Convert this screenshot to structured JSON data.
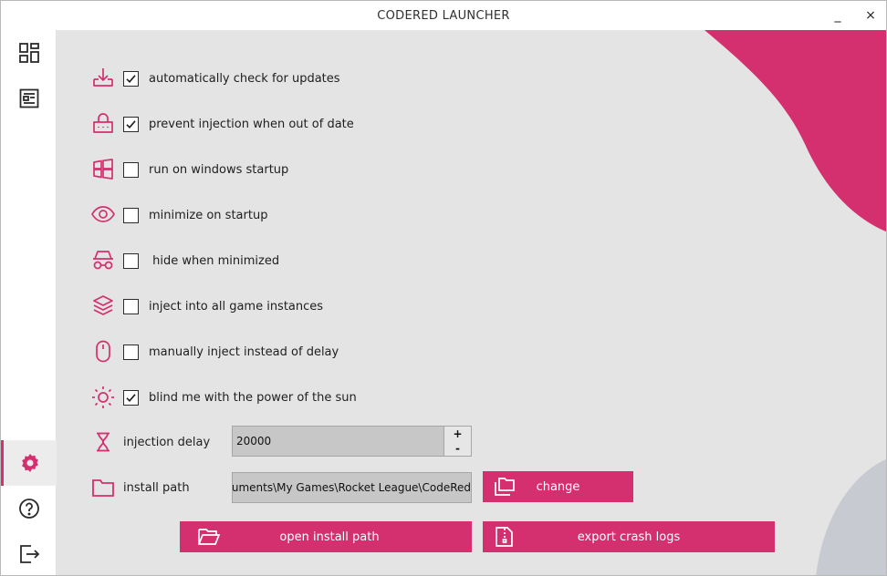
{
  "window": {
    "title": "CODERED LAUNCHER",
    "minimize": "_",
    "close": "×"
  },
  "colors": {
    "accent": "#d42f6e",
    "background": "#e4e4e4",
    "sidebar": "#ffffff",
    "blob_gray": "#c7cbd1"
  },
  "sidebar": {
    "items": [
      {
        "name": "dashboard",
        "icon": "dashboard-icon",
        "active": false
      },
      {
        "name": "news",
        "icon": "news-icon",
        "active": false
      },
      {
        "name": "settings",
        "icon": "gear-icon",
        "active": true
      },
      {
        "name": "help",
        "icon": "question-icon",
        "active": false
      },
      {
        "name": "exit",
        "icon": "exit-icon",
        "active": false
      }
    ]
  },
  "settings": {
    "options": [
      {
        "icon": "download-icon",
        "label": "automatically check for updates",
        "checked": true
      },
      {
        "icon": "lock-icon",
        "label": "prevent injection when out of date",
        "checked": true
      },
      {
        "icon": "windows-icon",
        "label": "run on windows startup",
        "checked": false
      },
      {
        "icon": "eye-icon",
        "label": "minimize on startup",
        "checked": false
      },
      {
        "icon": "incognito-icon",
        "label": " hide when minimized",
        "checked": false
      },
      {
        "icon": "layers-icon",
        "label": "inject into all game instances",
        "checked": false
      },
      {
        "icon": "mouse-icon",
        "label": "manually inject instead of delay",
        "checked": false
      },
      {
        "icon": "sun-icon",
        "label": "blind me with the power of the sun",
        "checked": true
      }
    ],
    "injection_delay": {
      "icon": "hourglass-icon",
      "label": "injection delay",
      "value": "20000",
      "increment": "+",
      "decrement": "-"
    },
    "install_path": {
      "icon": "folder-icon",
      "label": "install path",
      "value": "Documents\\My Games\\Rocket League\\CodeRed",
      "change_button": "change"
    },
    "open_install_path_button": "open install path",
    "export_crash_logs_button": "export crash logs"
  }
}
